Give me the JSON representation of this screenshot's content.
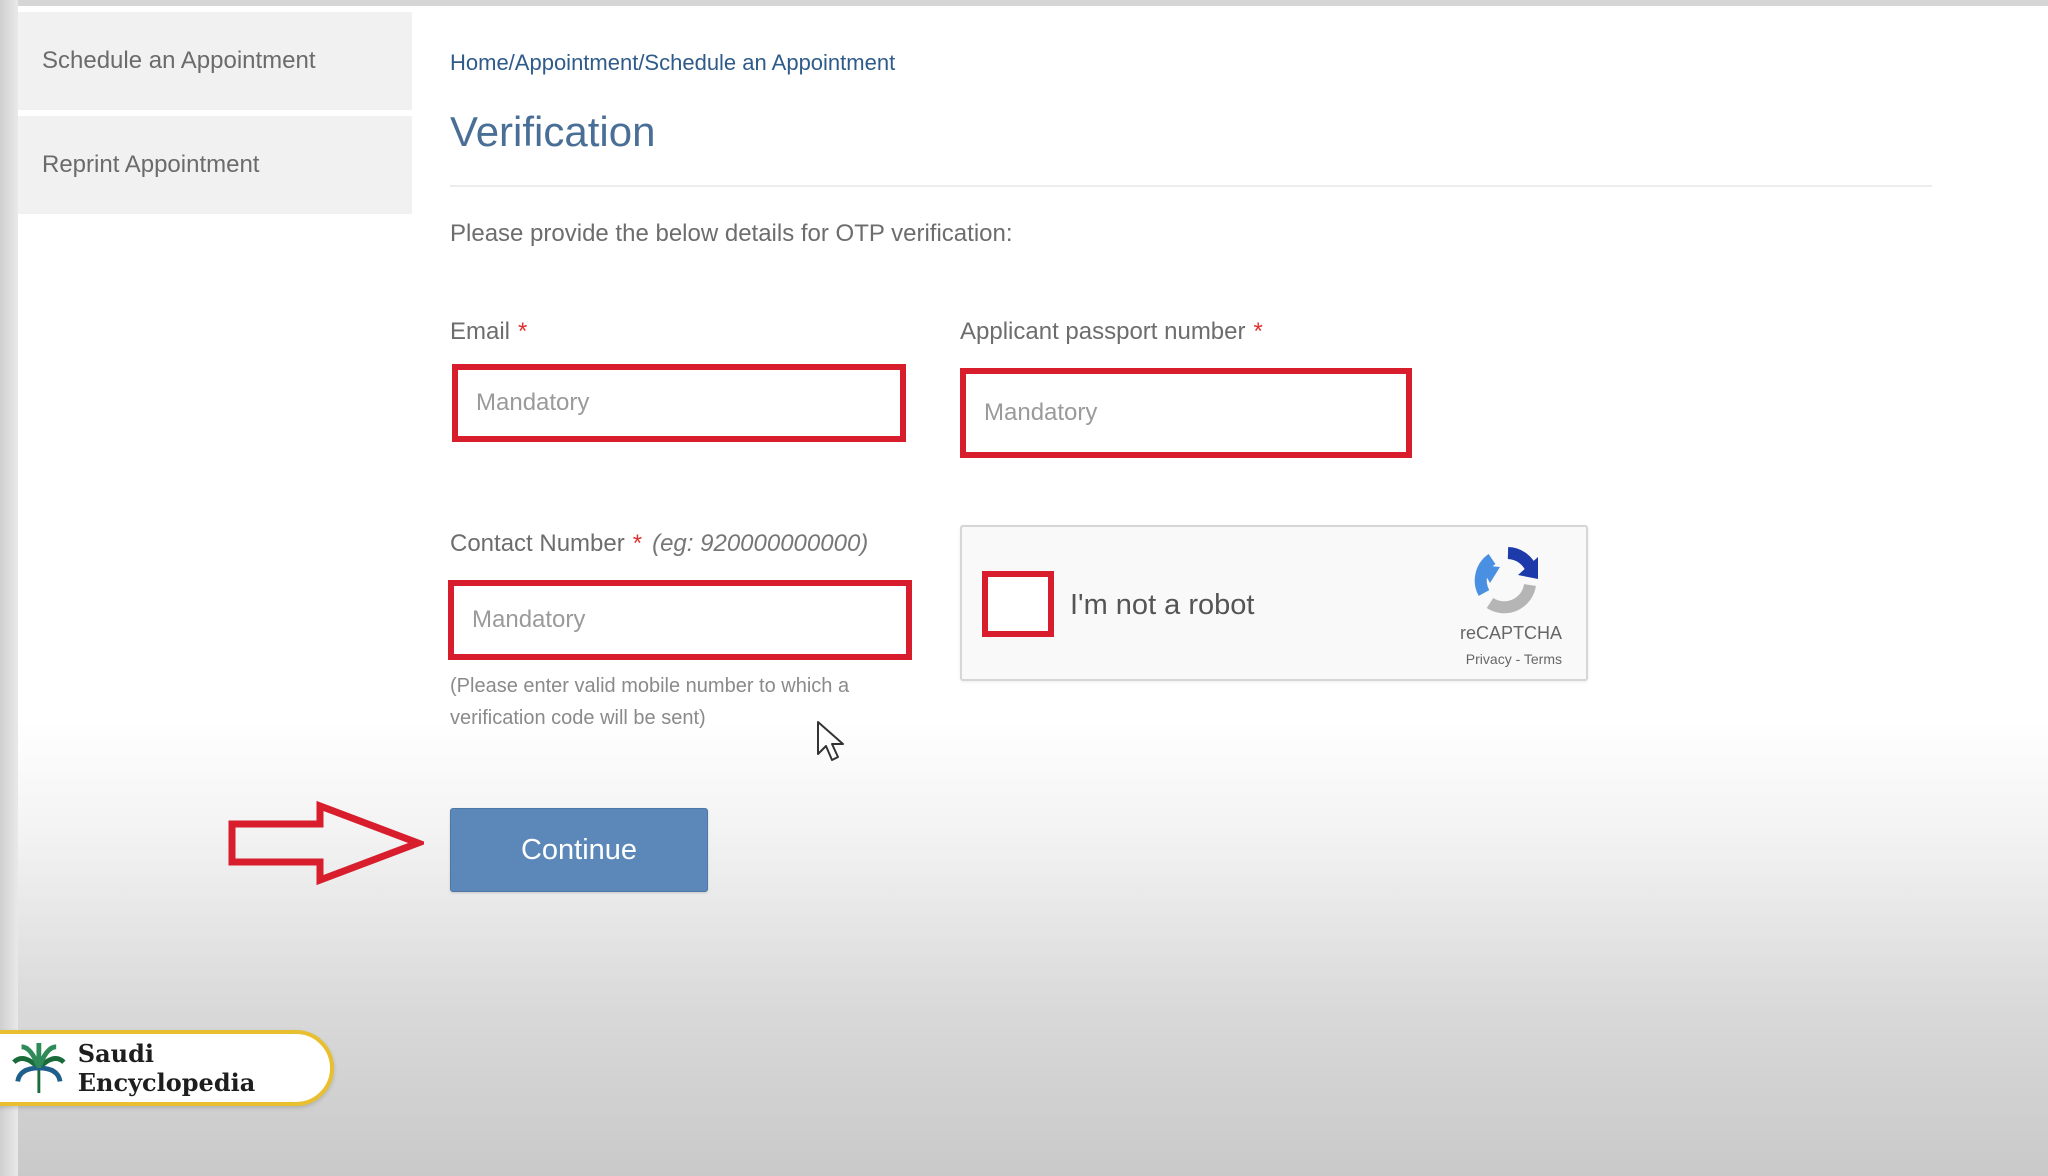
{
  "sidebar": {
    "items": [
      {
        "label": "Schedule an Appointment"
      },
      {
        "label": "Reprint Appointment"
      }
    ]
  },
  "main": {
    "breadcrumb": "Home/Appointment/Schedule an Appointment",
    "title": "Verification",
    "instruction": "Please provide the below details for OTP verification:"
  },
  "form": {
    "email": {
      "label": "Email",
      "required_mark": "*",
      "placeholder": "Mandatory",
      "value": ""
    },
    "passport": {
      "label": "Applicant passport number",
      "required_mark": "*",
      "placeholder": "Mandatory",
      "value": ""
    },
    "contact": {
      "label": "Contact Number",
      "required_mark": "*",
      "example": "(eg: 920000000000)",
      "placeholder": "Mandatory",
      "value": "",
      "hint": "(Please enter valid mobile number to which a verification code will be sent)"
    },
    "captcha": {
      "label": "I'm not a robot",
      "brand": "reCAPTCHA",
      "links": "Privacy - Terms",
      "checked": false
    },
    "continue_label": "Continue"
  },
  "watermark": {
    "text": "Saudi Encyclopedia"
  },
  "colors": {
    "highlight": "#d81e2c",
    "button": "#5b88b8",
    "title": "#4a6f96",
    "badge_border": "#e8bf2f"
  }
}
